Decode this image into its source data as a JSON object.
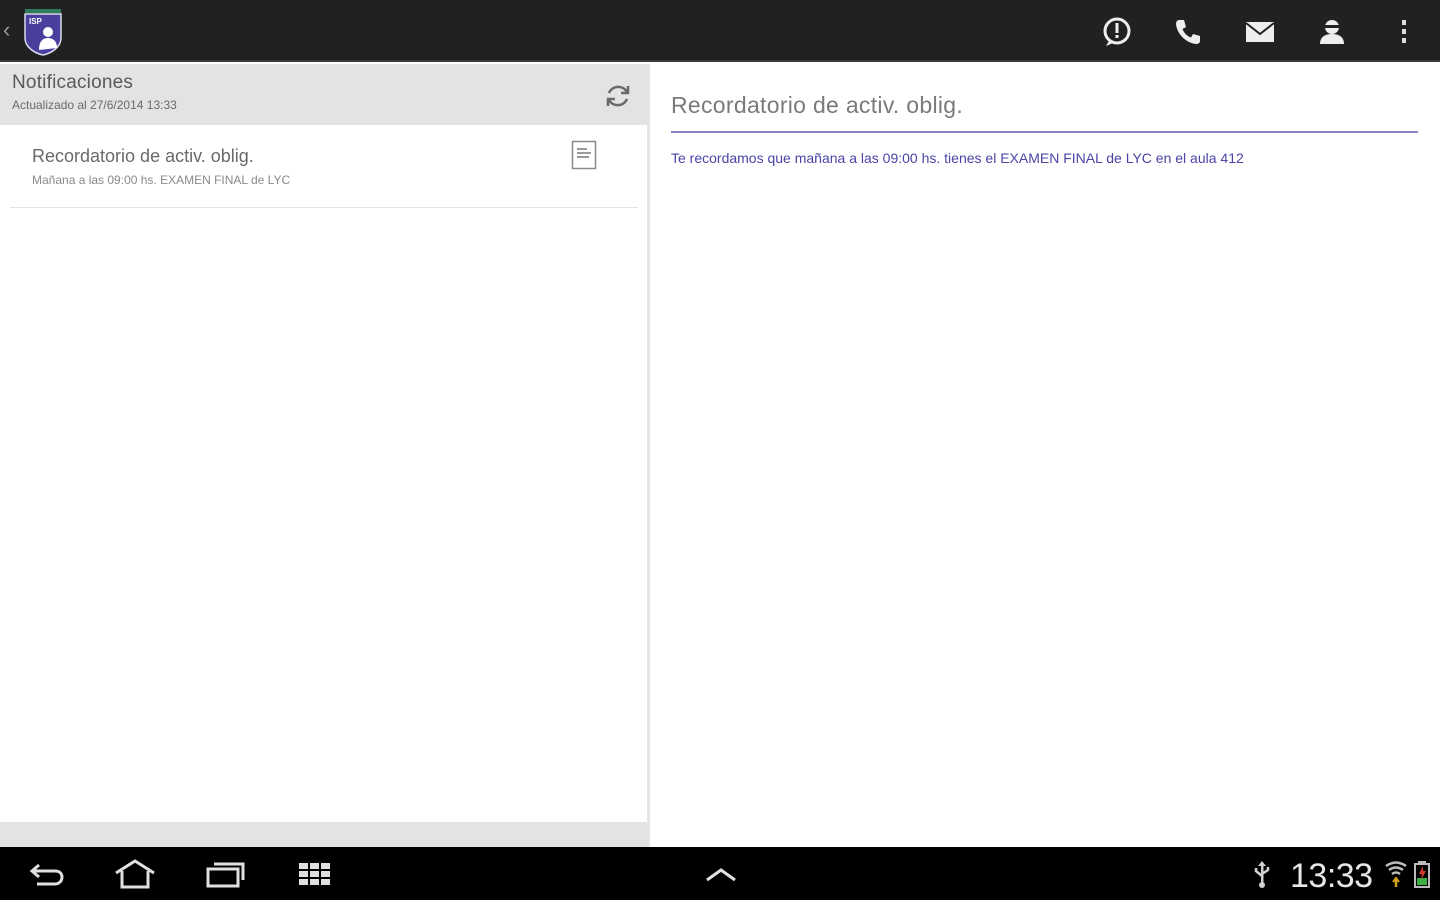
{
  "action_bar": {
    "up_caret": "‹",
    "logo_icon": "school-shield-logo",
    "actions": [
      {
        "name": "alert-icon"
      },
      {
        "name": "phone-icon"
      },
      {
        "name": "mail-icon"
      },
      {
        "name": "contact-icon"
      },
      {
        "name": "overflow-menu-icon"
      }
    ]
  },
  "list": {
    "title": "Notificaciones",
    "updated": "Actualizado al 27/6/2014 13:33",
    "items": [
      {
        "title": "Recordatorio de activ. oblig.",
        "snippet": "Mañana a las 09:00 hs. EXAMEN FINAL de LYC",
        "icon": "document-icon"
      }
    ]
  },
  "detail": {
    "title": "Recordatorio de activ. oblig.",
    "body": "Te recordamos que mañana a las 09:00 hs. tienes el EXAMEN FINAL de LYC en el aula 412"
  },
  "system_bar": {
    "clock": "13:33"
  },
  "colors": {
    "action_bar_bg": "#212121",
    "accent": "#4a45a6",
    "rule": "#8a86c4",
    "list_header_bg": "#e3e3e3"
  }
}
